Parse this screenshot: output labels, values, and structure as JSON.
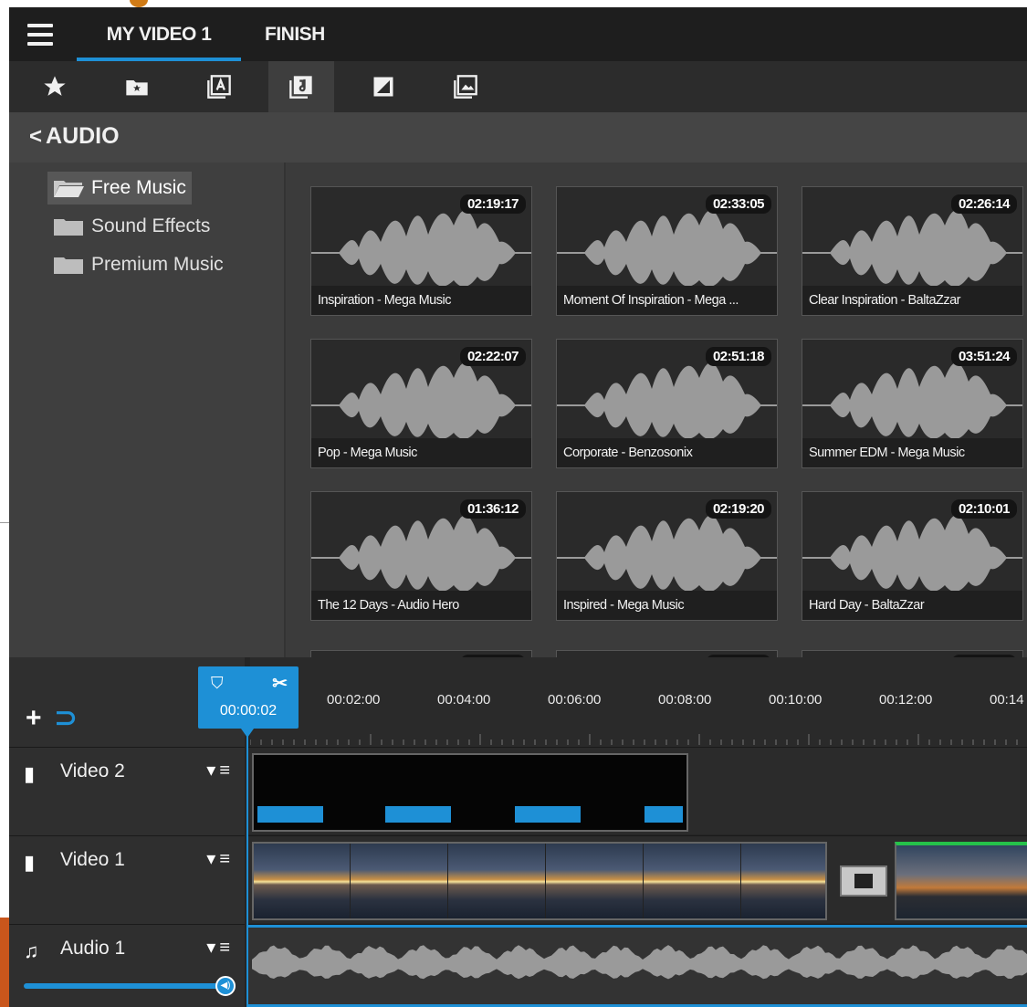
{
  "titlebar": {
    "project_tab": "MY VIDEO 1",
    "finish_tab": "FINISH"
  },
  "toolbar": {
    "tools": [
      "favorites-icon",
      "my-media-icon",
      "titles-icon",
      "audio-icon",
      "transitions-icon",
      "images-icon"
    ],
    "active": "audio-icon"
  },
  "section": {
    "back_label": "AUDIO"
  },
  "folders": {
    "items": [
      {
        "label": "Free Music",
        "active": true
      },
      {
        "label": "Sound Effects",
        "active": false
      },
      {
        "label": "Premium Music",
        "active": false
      }
    ]
  },
  "tracks_library": {
    "items": [
      {
        "title": "Inspiration - Mega Music",
        "duration": "02:19:17"
      },
      {
        "title": "Moment Of Inspiration - Mega ...",
        "duration": "02:33:05"
      },
      {
        "title": "Clear Inspiration - BaltaZzar",
        "duration": "02:26:14"
      },
      {
        "title": "Pop - Mega Music",
        "duration": "02:22:07"
      },
      {
        "title": "Corporate - Benzosonix",
        "duration": "02:51:18"
      },
      {
        "title": "Summer EDM - Mega Music",
        "duration": "03:51:24"
      },
      {
        "title": "The 12 Days - Audio Hero",
        "duration": "01:36:12"
      },
      {
        "title": "Inspired - Mega Music",
        "duration": "02:19:20"
      },
      {
        "title": "Hard Day - BaltaZzar",
        "duration": "02:10:01"
      }
    ]
  },
  "timeline": {
    "playhead_time": "00:00:02",
    "ruler_labels": [
      "00:02:00",
      "00:04:00",
      "00:06:00",
      "00:08:00",
      "00:10:00",
      "00:12:00",
      "00:14"
    ],
    "tracks": [
      {
        "name": "Video 2",
        "type": "video"
      },
      {
        "name": "Video 1",
        "type": "video"
      },
      {
        "name": "Audio 1",
        "type": "audio"
      }
    ],
    "volume_level": 1.0
  },
  "colors": {
    "accent": "#1e90d6",
    "background": "#3b3b3b",
    "titlebar": "#1e1e1e"
  }
}
